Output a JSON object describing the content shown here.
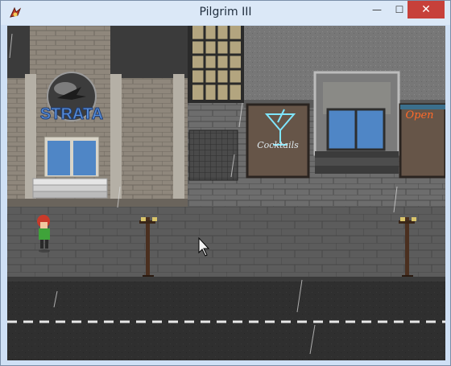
{
  "window": {
    "title": "Pilgrim III",
    "controls": {
      "minimize": "—",
      "maximize": "☐",
      "close": "✕"
    }
  },
  "scene": {
    "signs": {
      "strata": "STRATA",
      "cocktails": "Cocktails",
      "open": "Open"
    },
    "colors": {
      "sidewalk": "#5c5c5c",
      "road": "#2f2f2f",
      "road_line": "#e8e8e8",
      "neon_cyan": "#7fe6ff",
      "neon_orange": "#ff6a2a",
      "character_hair": "#c83a2a",
      "character_shirt": "#3fa33a"
    }
  }
}
